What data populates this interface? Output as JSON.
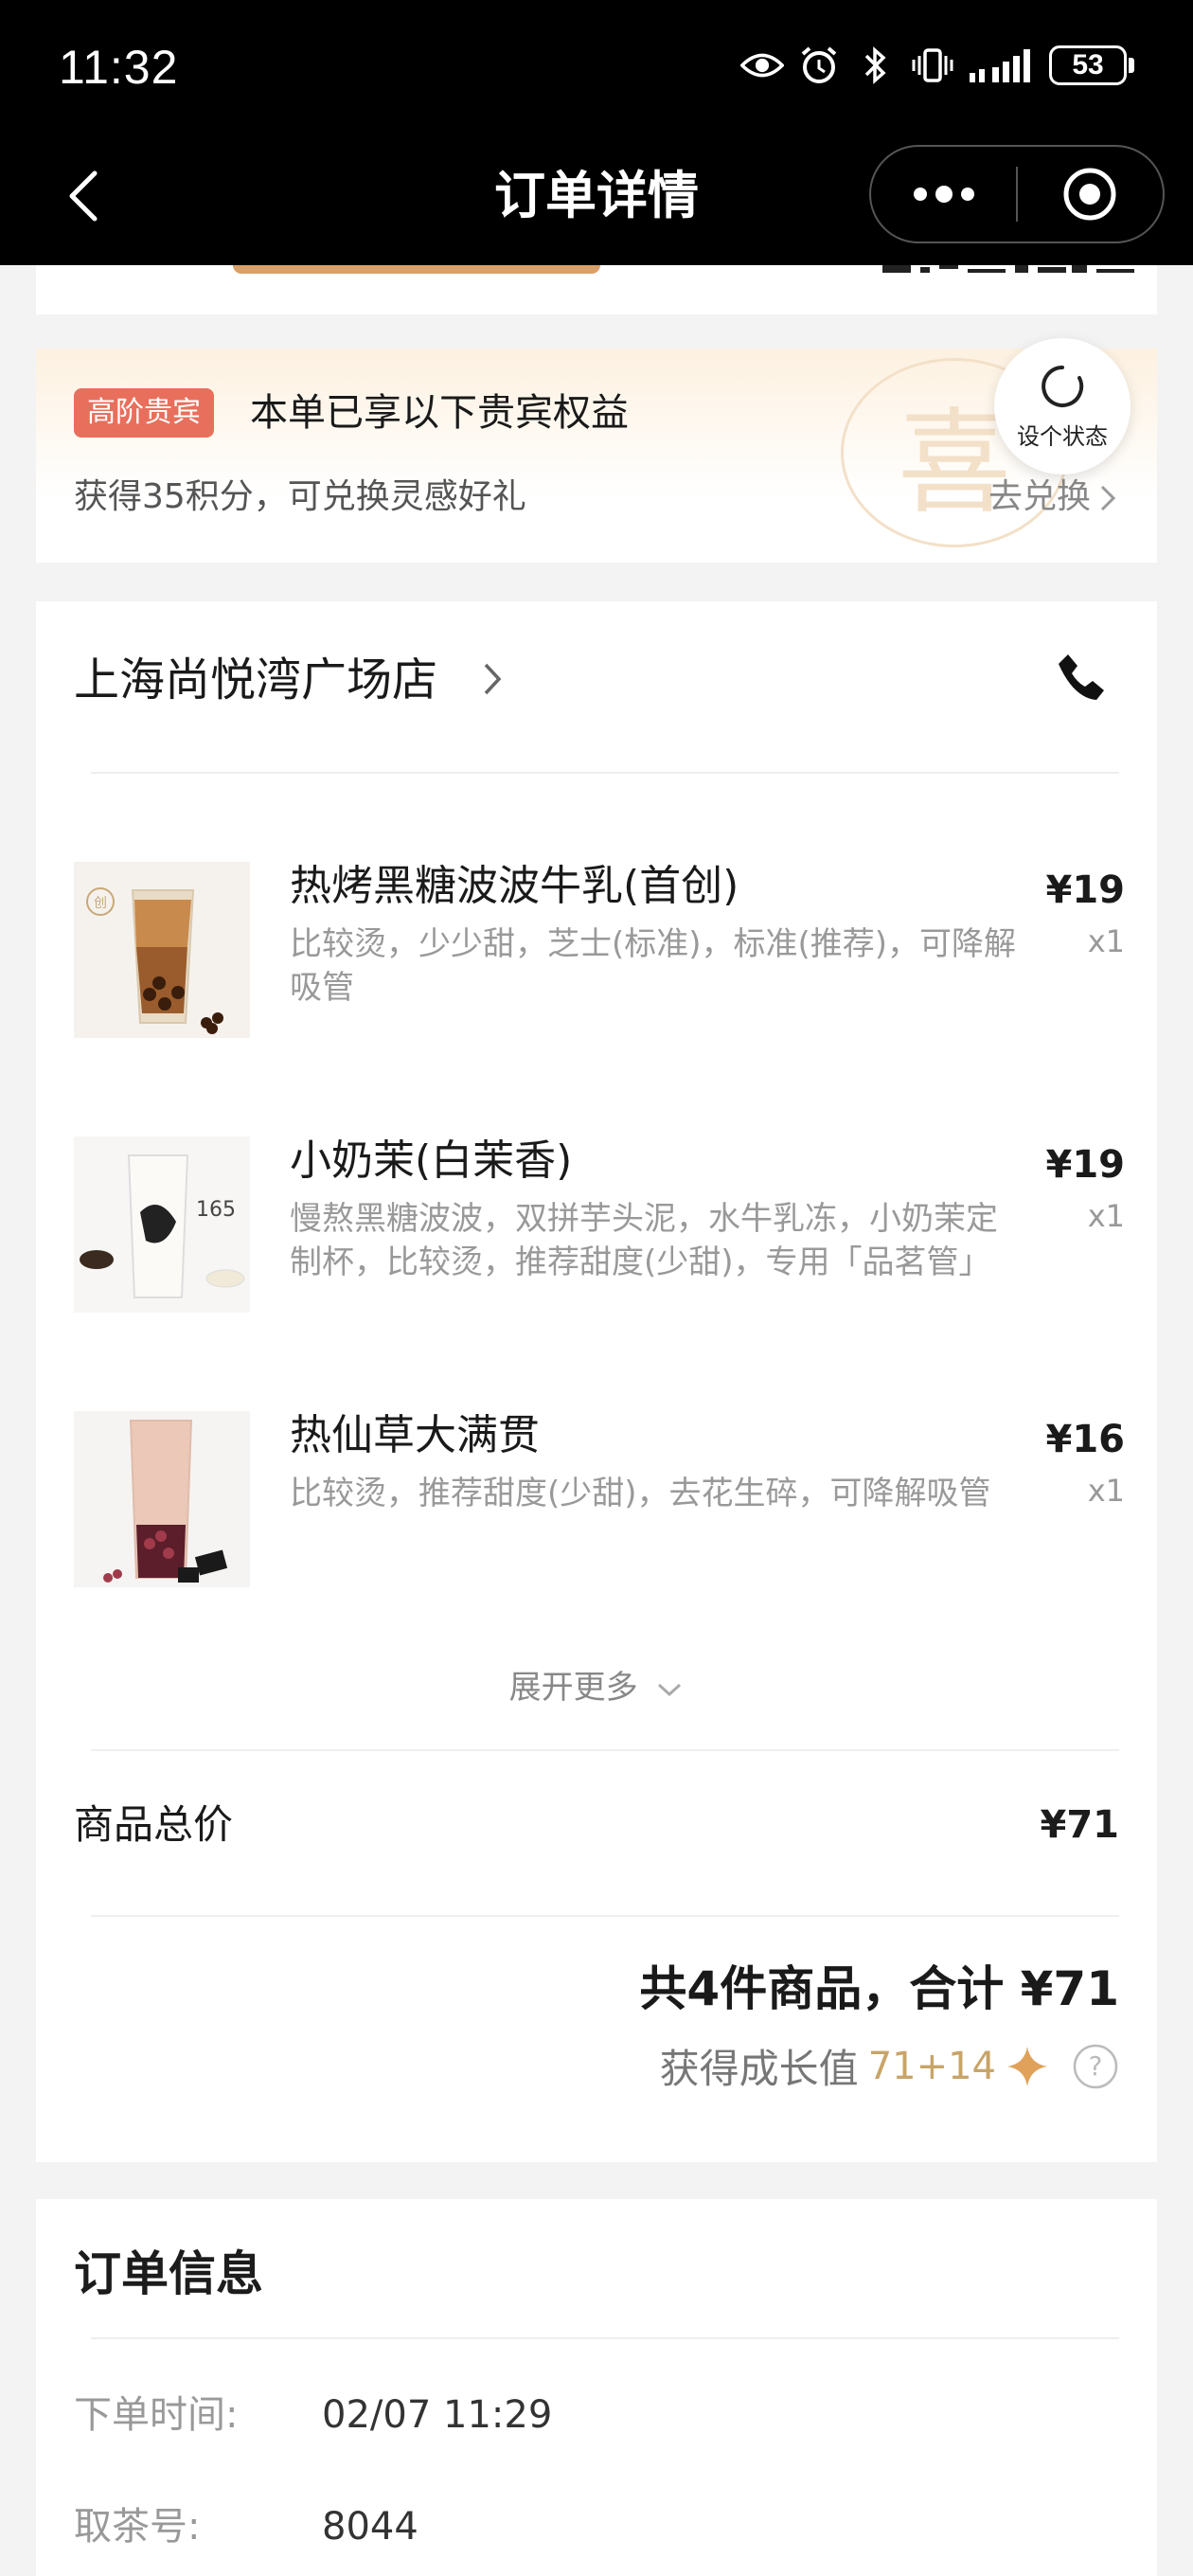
{
  "status_bar": {
    "time": "11:32",
    "battery": "53"
  },
  "nav": {
    "title": "订单详情"
  },
  "vip": {
    "badge": "高阶贵宾",
    "title": "本单已享以下贵宾权益",
    "subtitle": "获得35积分，可兑换灵感好礼",
    "link": "去兑换",
    "watermark": "喜",
    "status_bubble": "设个状态"
  },
  "order": {
    "store": "上海尚悦湾广场店",
    "items": [
      {
        "name": "热烤黑糖波波牛乳(首创)",
        "spec": "比较烫，少少甜，芝士(标准)，标准(推荐)，可降解吸管",
        "price": "¥19",
        "qty": "x1",
        "img_label": "创"
      },
      {
        "name": "小奶茉(白茉香)",
        "spec": "慢熬黑糖波波，双拼芋头泥，水牛乳冻，小奶茉定制杯，比较烫，推荐甜度(少甜)，专用「品茗管」",
        "price": "¥19",
        "qty": "x1",
        "img_label": "165"
      },
      {
        "name": "热仙草大满贯",
        "spec": "比较烫，推荐甜度(少甜)，去花生碎，可降解吸管",
        "price": "¥16",
        "qty": "x1"
      }
    ],
    "expand": "展开更多",
    "total_label": "商品总价",
    "total_value": "¥71",
    "summary": "共4件商品，合计 ¥71",
    "growth_label": "获得成长值",
    "growth_value": "71+14"
  },
  "info": {
    "title": "订单信息",
    "rows": [
      {
        "key": "下单时间:",
        "value": "02/07 11:29"
      },
      {
        "key": "取茶号:",
        "value": "8044"
      }
    ]
  },
  "colors": {
    "vip_badge": "#e86f5c",
    "growth_gold": "#c8a467",
    "top_button": "#d9a06a"
  }
}
